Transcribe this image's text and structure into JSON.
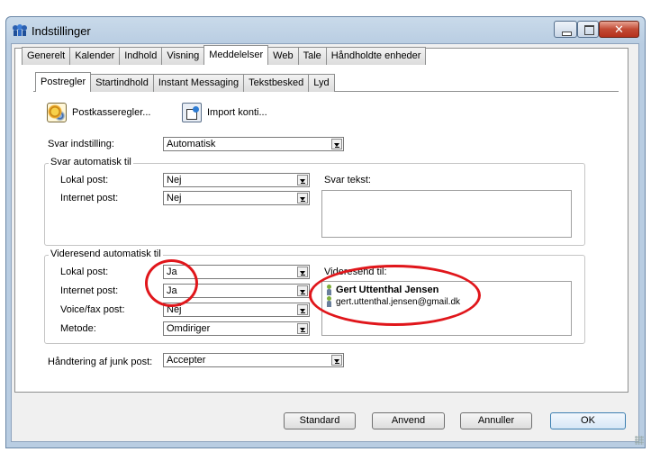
{
  "window": {
    "title": "Indstillinger"
  },
  "outer_tabs": [
    "Generelt",
    "Kalender",
    "Indhold",
    "Visning",
    "Meddelelser",
    "Web",
    "Tale",
    "Håndholdte enheder"
  ],
  "inner_tabs": [
    "Postregler",
    "Startindhold",
    "Instant Messaging",
    "Tekstbesked",
    "Lyd"
  ],
  "toolbar": {
    "mailbox_rules": "Postkasseregler...",
    "import_accounts": "Import konti..."
  },
  "reply_setting": {
    "label": "Svar indstilling:",
    "value": "Automatisk"
  },
  "auto_reply": {
    "title": "Svar automatisk til",
    "local_label": "Lokal post:",
    "local_value": "Nej",
    "internet_label": "Internet post:",
    "internet_value": "Nej",
    "text_label": "Svar tekst:"
  },
  "auto_forward": {
    "title": "Videresend automatisk til",
    "local_label": "Lokal post:",
    "local_value": "Ja",
    "internet_label": "Internet post:",
    "internet_value": "Ja",
    "voice_label": "Voice/fax post:",
    "voice_value": "Nej",
    "method_label": "Metode:",
    "method_value": "Omdiriger",
    "forward_to_label": "Videresend til:",
    "recipients": [
      "Gert Uttenthal Jensen",
      "gert.uttenthal.jensen@gmail.dk"
    ]
  },
  "junk": {
    "label": "Håndtering af junk post:",
    "value": "Accepter"
  },
  "buttons": {
    "standard": "Standard",
    "apply": "Anvend",
    "cancel": "Annuller",
    "ok": "OK"
  },
  "colors": {
    "annotation": "#e0161b",
    "accent": "#3c7fb1"
  }
}
